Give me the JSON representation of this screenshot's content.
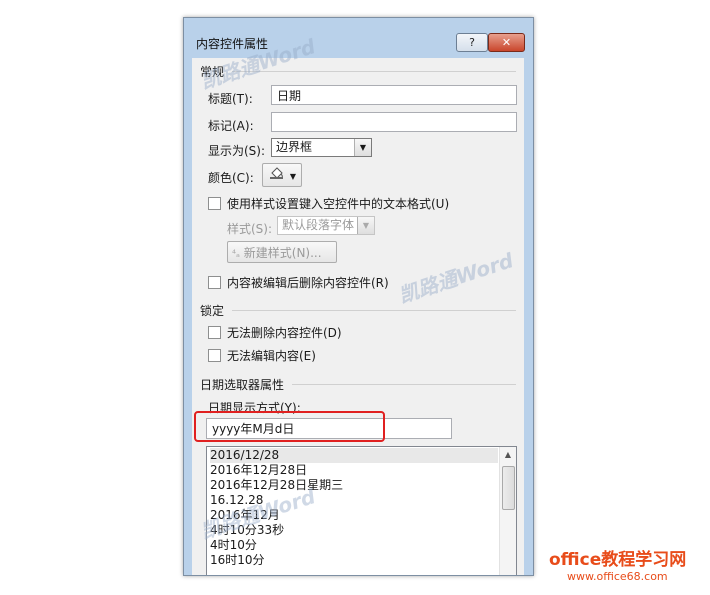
{
  "window": {
    "title": "内容控件属性",
    "help_label": "?",
    "close_label": "✕"
  },
  "general": {
    "section": "常规",
    "title_label": "标题(T):",
    "title_value": "日期",
    "tag_label": "标记(A):",
    "tag_value": "",
    "show_as_label": "显示为(S):",
    "show_as_value": "边界框",
    "color_label": "颜色(C):",
    "use_style_label": "使用样式设置键入空控件中的文本格式(U)",
    "style_label": "样式(S):",
    "style_value": "默认段落字体",
    "new_style_label": "新建样式(N)...",
    "remove_label": "内容被编辑后删除内容控件(R)"
  },
  "locking": {
    "section": "锁定",
    "no_delete_label": "无法删除内容控件(D)",
    "no_edit_label": "无法编辑内容(E)"
  },
  "date_picker": {
    "section": "日期选取器属性",
    "format_label": "日期显示方式(Y):",
    "format_value": "yyyy年M月d日",
    "formats": [
      "2016/12/28",
      "2016年12月28日",
      "2016年12月28日星期三",
      "16.12.28",
      "2016年12月",
      "4时10分33秒",
      "4时10分",
      "16时10分"
    ]
  },
  "watermark": "凯路通Word",
  "brand": {
    "text": "office教程学习网",
    "url": "www.office68.com"
  },
  "colors": {
    "highlight": "#e02020",
    "brand": "#e84c1a",
    "frame": "#b9d1ea"
  }
}
